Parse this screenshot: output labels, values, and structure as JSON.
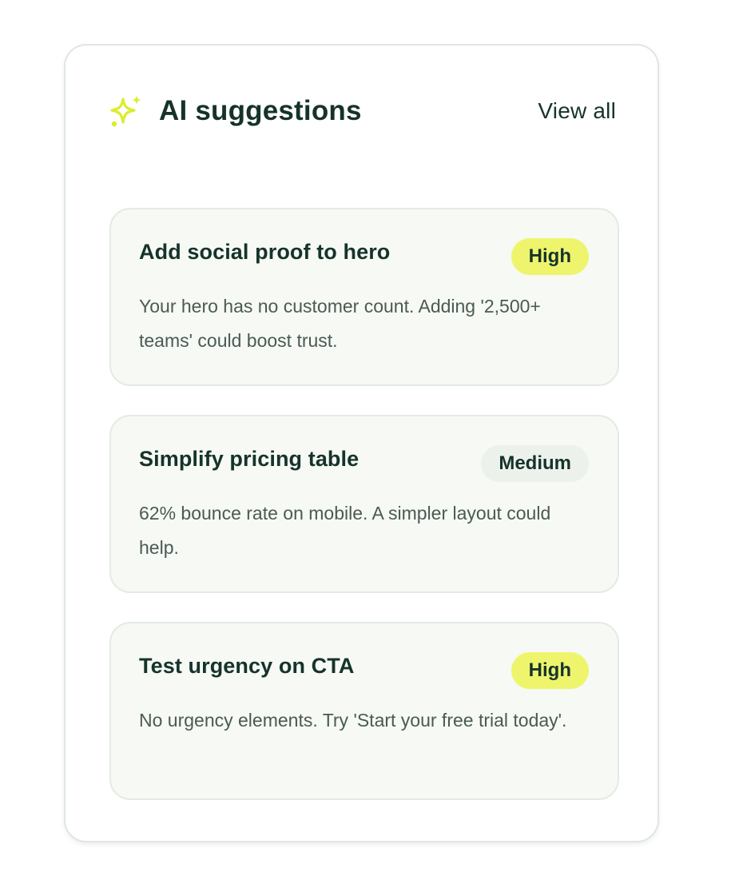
{
  "panel": {
    "title": "AI suggestions",
    "view_all_label": "View all",
    "icon": "sparkle-icon",
    "accent_color": "#d9ee2a"
  },
  "suggestions": [
    {
      "title": "Add social proof to hero",
      "priority": "High",
      "description": "Your hero has no customer count. Adding '2,500+ teams' could boost trust."
    },
    {
      "title": "Simplify pricing table",
      "priority": "Medium",
      "description": "62% bounce rate on mobile. A simpler layout could help."
    },
    {
      "title": "Test urgency on CTA",
      "priority": "High",
      "description": "No urgency elements. Try 'Start your free trial today'."
    }
  ],
  "colors": {
    "high_badge": "#eef56d",
    "medium_badge": "#edf1ec",
    "text_primary": "#16332b",
    "text_secondary": "#4a5a55",
    "card_bg": "#f6f9f4"
  }
}
